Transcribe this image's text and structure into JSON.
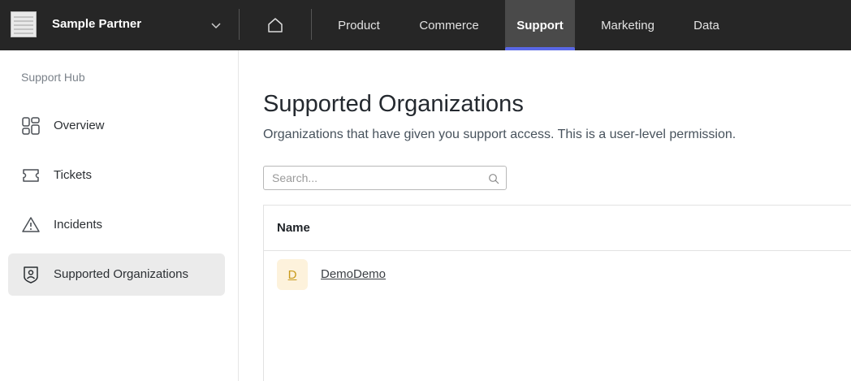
{
  "header": {
    "partner_name": "Sample Partner",
    "nav": [
      {
        "label": "Product",
        "active": false
      },
      {
        "label": "Commerce",
        "active": false
      },
      {
        "label": "Support",
        "active": true
      },
      {
        "label": "Marketing",
        "active": false
      },
      {
        "label": "Data",
        "active": false
      }
    ],
    "active_accent": "#5a68e6"
  },
  "sidebar": {
    "title": "Support Hub",
    "items": [
      {
        "label": "Overview",
        "icon": "grid-icon",
        "active": false
      },
      {
        "label": "Tickets",
        "icon": "ticket-icon",
        "active": false
      },
      {
        "label": "Incidents",
        "icon": "warning-icon",
        "active": false
      },
      {
        "label": "Supported Organizations",
        "icon": "shield-user-icon",
        "active": true
      }
    ]
  },
  "main": {
    "title": "Supported Organizations",
    "subtitle": "Organizations that have given you support access. This is a user-level permission.",
    "search": {
      "placeholder": "Search...",
      "value": ""
    },
    "table": {
      "columns": [
        "Name"
      ],
      "rows": [
        {
          "initial": "D",
          "name": "DemoDemo"
        }
      ]
    }
  }
}
